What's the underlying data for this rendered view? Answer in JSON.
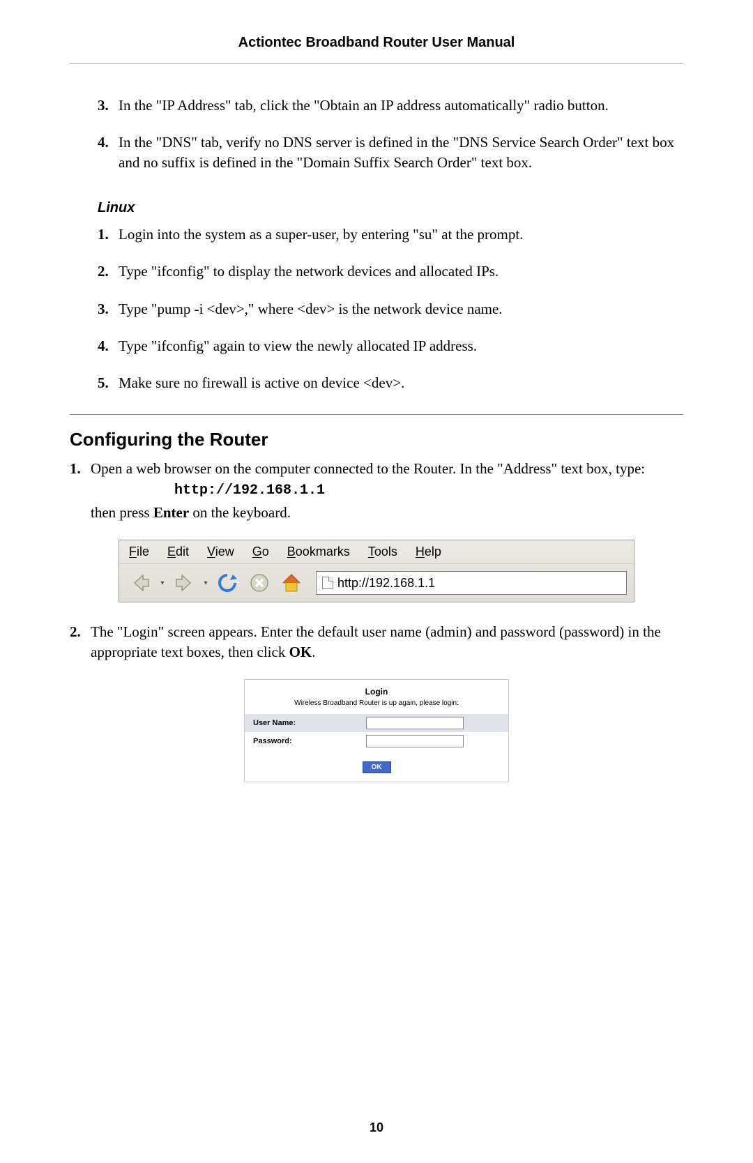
{
  "header": {
    "title": "Actiontec Broadband Router User Manual"
  },
  "top_steps": [
    {
      "n": "3.",
      "text": "In the \"IP Address\" tab,  click the \"Obtain an IP address automatically\" radio button."
    },
    {
      "n": "4.",
      "text": "In the \"DNS\" tab, verify no DNS server is defined in the \"DNS Service Search Order\" text box and no suffix is defined in the \"Domain Suffix Search Order\" text box."
    }
  ],
  "linux": {
    "heading": "Linux",
    "steps": [
      {
        "n": "1.",
        "text": "Login into the system as a super-user, by entering \"su\" at the prompt."
      },
      {
        "n": "2.",
        "text": "Type \"ifconfig\" to display the network devices and allocated IPs."
      },
      {
        "n": "3.",
        "text": "Type \"pump -i <dev>,\" where <dev> is the network device name."
      },
      {
        "n": "4.",
        "text": "Type \"ifconfig\" again to view the newly allocated IP address."
      },
      {
        "n": "5.",
        "text": "Make sure no firewall is active on device <dev>."
      }
    ]
  },
  "config": {
    "heading": "Configuring the Router",
    "step1": {
      "n": "1.",
      "pre": "Open a web browser on the computer connected to the Router. In the \"Address\" text box, type:",
      "url": "http://192.168.1.1",
      "post_a": "then press ",
      "post_b": "Enter",
      "post_c": " on the keyboard."
    },
    "step2": {
      "n": "2.",
      "pre": "The \"Login\" screen appears. Enter the default user name (admin) and password (password) in the appropriate text boxes, then click ",
      "bold": "OK",
      "post": "."
    }
  },
  "browser": {
    "menus": [
      "File",
      "Edit",
      "View",
      "Go",
      "Bookmarks",
      "Tools",
      "Help"
    ],
    "address": "http://192.168.1.1"
  },
  "login": {
    "title": "Login",
    "message": "Wireless Broadband Router is up again, please login:",
    "user_label": "User Name:",
    "pass_label": "Password:",
    "ok": "OK"
  },
  "page_number": "10"
}
